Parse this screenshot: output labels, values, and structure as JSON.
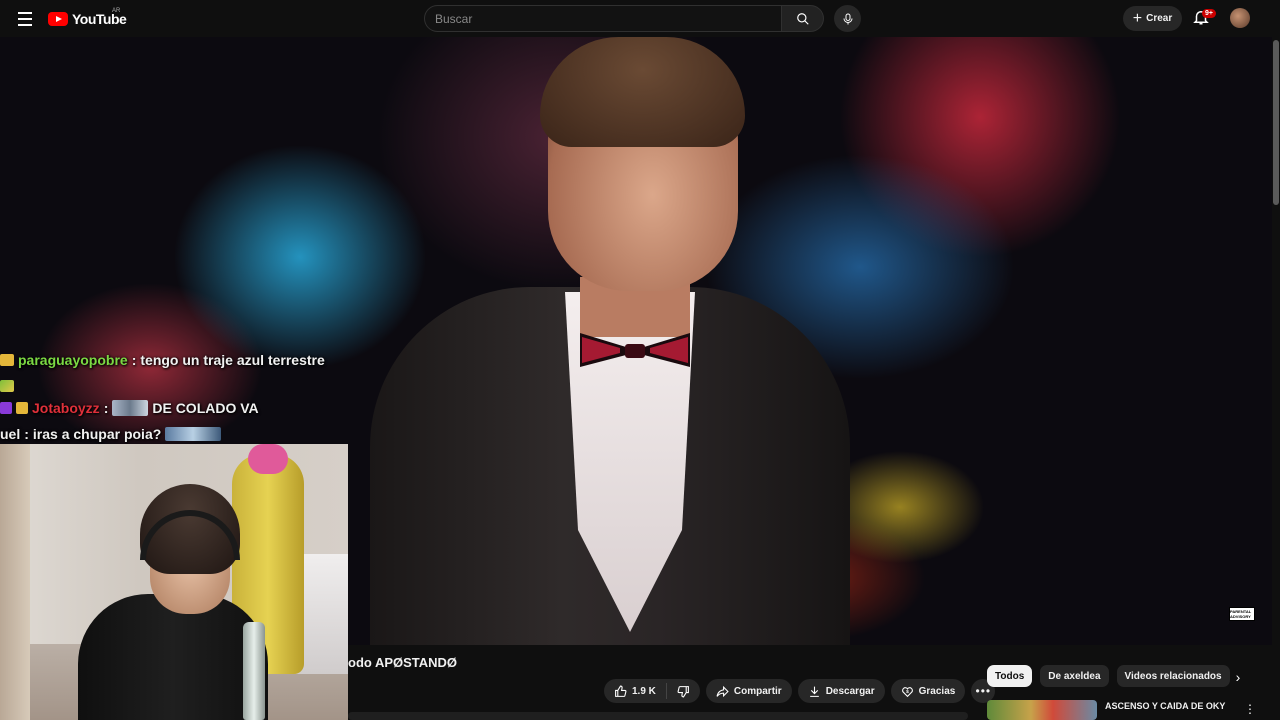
{
  "header": {
    "logo_text": "YouTube",
    "region": "AR",
    "search_placeholder": "Buscar",
    "create_label": "Crear",
    "notifications_badge": "9+"
  },
  "chat": [
    {
      "user": "paraguayopobre",
      "user_color": "#7bd943",
      "sep": " : ",
      "text": "tengo un traje azul terrestre"
    },
    {
      "user": "Jotaboyzz",
      "user_color": "#e0303a",
      "sep": " : ",
      "text": "DE COLADO VA"
    },
    {
      "user": "uel",
      "user_color": "#f1f1f1",
      "sep": " : ",
      "text": "iras a chupar poia?"
    }
  ],
  "video": {
    "title": "odo APØSTANDØ",
    "explicit_label": "PARENTAL ADVISORY"
  },
  "actions": {
    "likes": "1.9 K",
    "share": "Compartir",
    "download": "Descargar",
    "thanks": "Gracias"
  },
  "chips": [
    "Todos",
    "De axeldea",
    "Videos relacionados"
  ],
  "recommendation": {
    "title": "ASCENSO Y CAIDA DE OKY"
  }
}
